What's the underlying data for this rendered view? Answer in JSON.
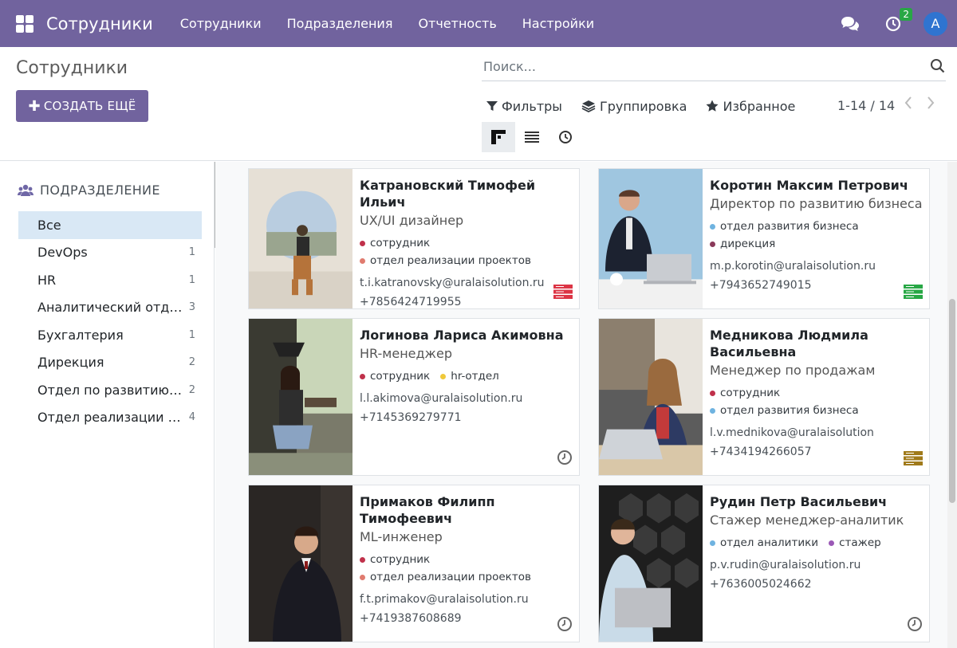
{
  "app": {
    "brand": "Сотрудники",
    "menu": [
      "Сотрудники",
      "Подразделения",
      "Отчетность",
      "Настройки"
    ],
    "activity_count": "2",
    "user_initial": "A",
    "nav_color": "#71639e"
  },
  "control": {
    "breadcrumb": "Сотрудники",
    "create_label": "СОЗДАТЬ ЕЩЁ",
    "search_placeholder": "Поиск...",
    "filters_label": "Фильтры",
    "groupby_label": "Группировка",
    "favorites_label": "Избранное",
    "pager": "1-14 / 14",
    "views": [
      "kanban-view-icon",
      "list-view-icon",
      "activity-view-icon"
    ]
  },
  "sidebar": {
    "header": "ПОДРАЗДЕЛЕНИЕ",
    "items": [
      {
        "label": "Все",
        "count": ""
      },
      {
        "label": "DevOps",
        "count": "1"
      },
      {
        "label": "HR",
        "count": "1"
      },
      {
        "label": "Аналитический отдел",
        "count": "3"
      },
      {
        "label": "Бухгалтерия",
        "count": "1"
      },
      {
        "label": "Дирекция",
        "count": "2"
      },
      {
        "label": "Отдел по развитию бизнеса",
        "count": "2"
      },
      {
        "label": "Отдел реализации проектов",
        "count": "4"
      }
    ]
  },
  "employees": [
    {
      "name": "Катрановский Тимофей Ильич",
      "job": "UX/UI дизайнер",
      "tags": [
        {
          "label": "сотрудник",
          "color": "#c0314b"
        },
        {
          "label": "отдел реализации проектов",
          "color": "#e07b6f"
        }
      ],
      "email": "t.i.katranovsky@uralaisolution.ru",
      "phone": "+7856424719955",
      "status_icon": "presence-server-icon",
      "status_color": "#dc3545"
    },
    {
      "name": "Коротин Максим Петрович",
      "job": "Директор по развитию бизнеса",
      "tags": [
        {
          "label": "отдел развития бизнеса",
          "color": "#6fb3e0"
        },
        {
          "label": "дирекция",
          "color": "#8a3a5a"
        }
      ],
      "email": "m.p.korotin@uralaisolution.ru",
      "phone": "+7943652749015",
      "status_icon": "presence-server-icon",
      "status_color": "#28a745"
    },
    {
      "name": "Логинова Лариса Акимовна",
      "job": "HR-менеджер",
      "tags": [
        {
          "label": "сотрудник",
          "color": "#c0314b"
        },
        {
          "label": "hr-отдел",
          "color": "#f0c93a"
        }
      ],
      "email": "l.l.akimova@uralaisolution.ru",
      "phone": "+7145369279771",
      "status_icon": "clock-icon",
      "status_color": "#666666"
    },
    {
      "name": "Медникова Людмила Васильевна",
      "job": "Менеджер по продажам",
      "tags": [
        {
          "label": "сотрудник",
          "color": "#c0314b"
        },
        {
          "label": "отдел развития бизнеса",
          "color": "#6fb3e0"
        }
      ],
      "email": "l.v.mednikova@uralaisolution",
      "phone": "+7434194266057",
      "status_icon": "presence-server-icon",
      "status_color": "#a07a1a"
    },
    {
      "name": "Примаков Филипп Тимофеевич",
      "job": "ML-инженер",
      "tags": [
        {
          "label": "сотрудник",
          "color": "#c0314b"
        },
        {
          "label": "отдел реализации проектов",
          "color": "#e07b6f"
        }
      ],
      "email": "f.t.primakov@uralaisolution.ru",
      "phone": "+7419387608689",
      "status_icon": "clock-icon",
      "status_color": "#666666"
    },
    {
      "name": "Рудин Петр Васильевич",
      "job": "Стажер менеджер-аналитик",
      "tags": [
        {
          "label": "отдел аналитики",
          "color": "#6fb3e0"
        },
        {
          "label": "стажер",
          "color": "#9b59b6"
        }
      ],
      "email": "p.v.rudin@uralaisolution.ru",
      "phone": "+7636005024662",
      "status_icon": "clock-icon",
      "status_color": "#666666"
    }
  ]
}
